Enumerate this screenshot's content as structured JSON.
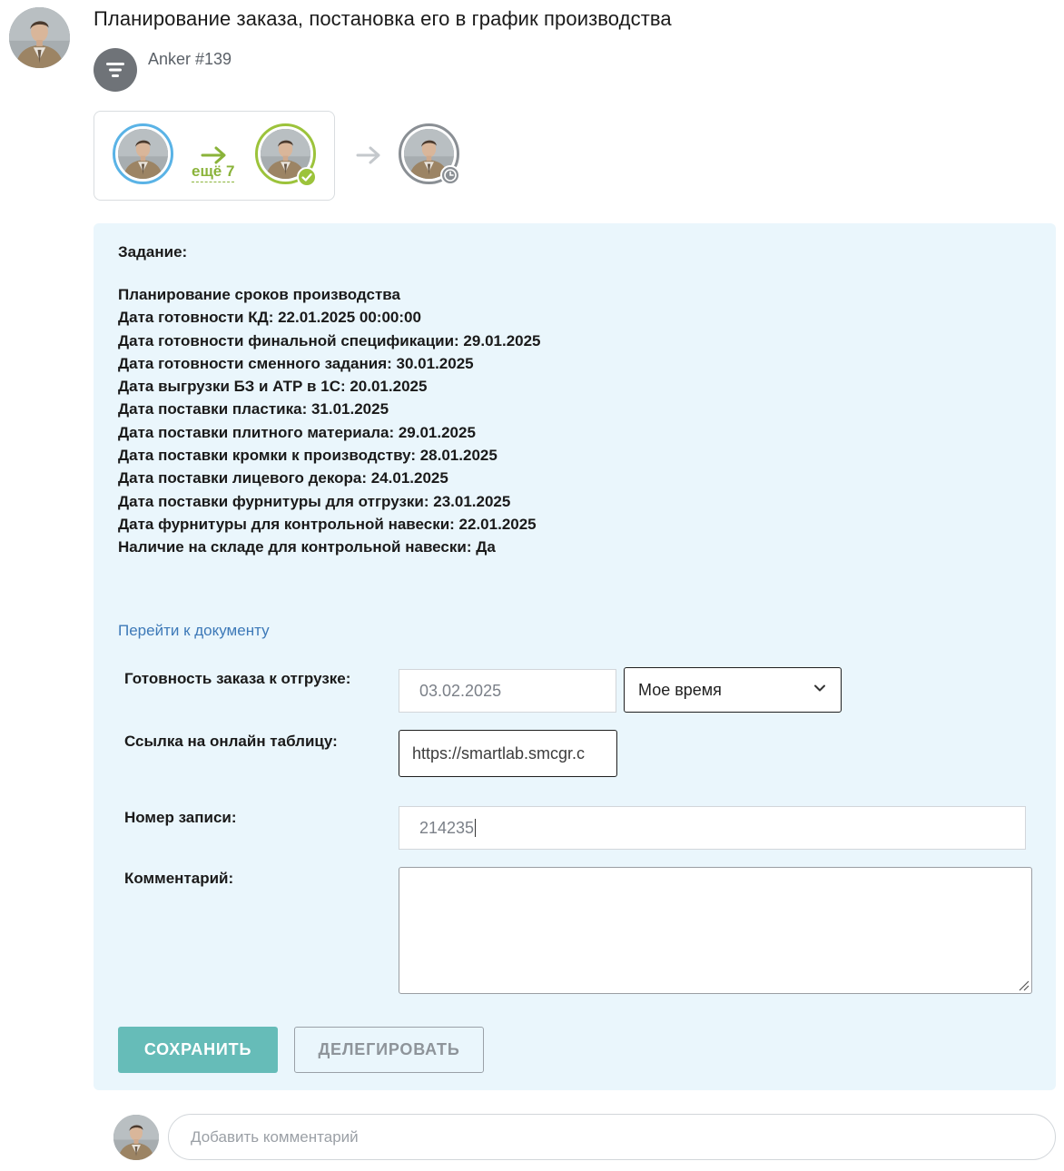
{
  "task": {
    "title": "Планирование заказа, постановка его в график производства",
    "process_name": "Anker #139",
    "process_icon": "filter-icon"
  },
  "route": {
    "more_label": "ещё 7",
    "first_status_color": "#5ab3e6",
    "current_status_color": "#9cc33b",
    "pending_status_color": "#8a8f94"
  },
  "content": {
    "heading": "Задание:",
    "lines": [
      "Планирование сроков производства",
      "Дата готовности КД: 22.01.2025 00:00:00",
      "Дата готовности финальной спецификации: 29.01.2025",
      "Дата готовности сменного задания: 30.01.2025",
      "Дата выгрузки БЗ и АТР в 1С: 20.01.2025",
      "Дата поставки пластика: 31.01.2025",
      "Дата поставки плитного материала: 29.01.2025",
      "Дата поставки кромки к производству: 28.01.2025",
      "Дата поставки лицевого декора: 24.01.2025",
      "Дата поставки фурнитуры для отгрузки: 23.01.2025",
      "Дата фурнитуры для контрольной навески: 22.01.2025",
      "Наличие на складе для контрольной навески: Да"
    ],
    "doc_link": "Перейти к документу"
  },
  "form": {
    "ready_label": "Готовность заказа к отгрузке:",
    "ready_date": "03.02.2025",
    "time_zone": "Мое время",
    "link_label": "Ссылка на онлайн таблицу:",
    "link_value": "https://smartlab.smcgr.c",
    "number_label": "Номер записи:",
    "number_value": "214235",
    "comment_label": "Комментарий:",
    "comment_value": ""
  },
  "actions": {
    "save_label": "СОХРАНИТЬ",
    "delegate_label": "ДЕЛЕГИРОВАТЬ"
  },
  "comments": {
    "placeholder": "Добавить комментарий"
  },
  "colors": {
    "accent": "#66bcb8",
    "card_bg": "#eaf6fc",
    "link": "#3d79b8",
    "more_green": "#8ab33a"
  }
}
